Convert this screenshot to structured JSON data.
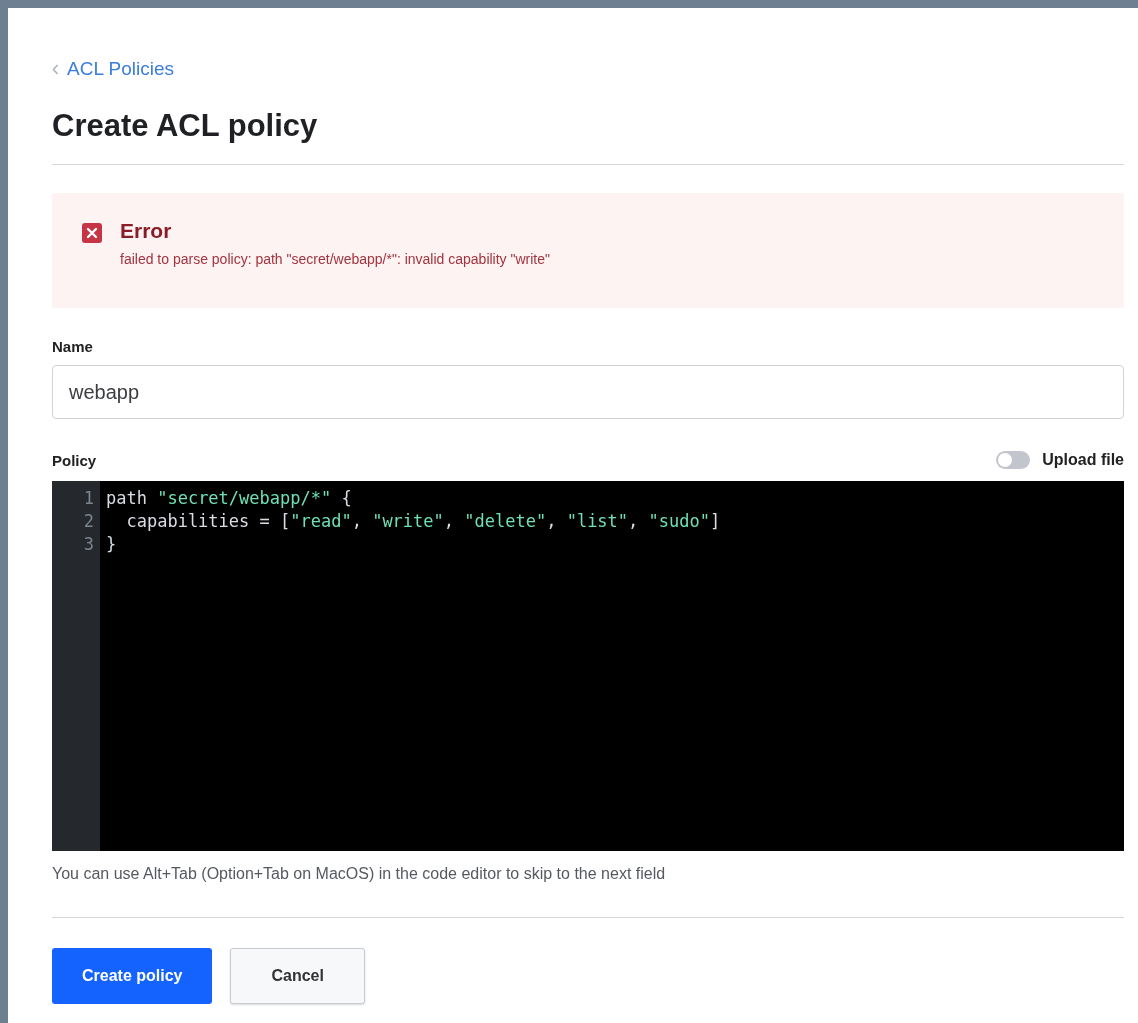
{
  "breadcrumb": {
    "label": "ACL Policies"
  },
  "title": "Create ACL policy",
  "error": {
    "title": "Error",
    "message": "failed to parse policy: path \"secret/webapp/*\": invalid capability \"write\""
  },
  "name_field": {
    "label": "Name",
    "value": "webapp"
  },
  "policy": {
    "label": "Policy",
    "upload_toggle": {
      "label": "Upload file",
      "on": false
    },
    "lines": [
      {
        "number": "1",
        "tokens": [
          {
            "kind": "plain",
            "text": "path "
          },
          {
            "kind": "string",
            "text": "\"secret/webapp/*\""
          },
          {
            "kind": "plain",
            "text": " {"
          }
        ]
      },
      {
        "number": "2",
        "tokens": [
          {
            "kind": "plain",
            "text": "  capabilities = ["
          },
          {
            "kind": "string",
            "text": "\"read\""
          },
          {
            "kind": "plain",
            "text": ", "
          },
          {
            "kind": "string",
            "text": "\"write\""
          },
          {
            "kind": "plain",
            "text": ", "
          },
          {
            "kind": "string",
            "text": "\"delete\""
          },
          {
            "kind": "plain",
            "text": ", "
          },
          {
            "kind": "string",
            "text": "\"list\""
          },
          {
            "kind": "plain",
            "text": ", "
          },
          {
            "kind": "string",
            "text": "\"sudo\""
          },
          {
            "kind": "plain",
            "text": "]"
          }
        ]
      },
      {
        "number": "3",
        "tokens": [
          {
            "kind": "plain",
            "text": "}"
          }
        ]
      }
    ],
    "help": "You can use Alt+Tab (Option+Tab on MacOS) in the code editor to skip to the next field"
  },
  "buttons": [
    {
      "label": "Create policy",
      "kind": "primary"
    },
    {
      "label": "Cancel",
      "kind": "secondary"
    }
  ]
}
